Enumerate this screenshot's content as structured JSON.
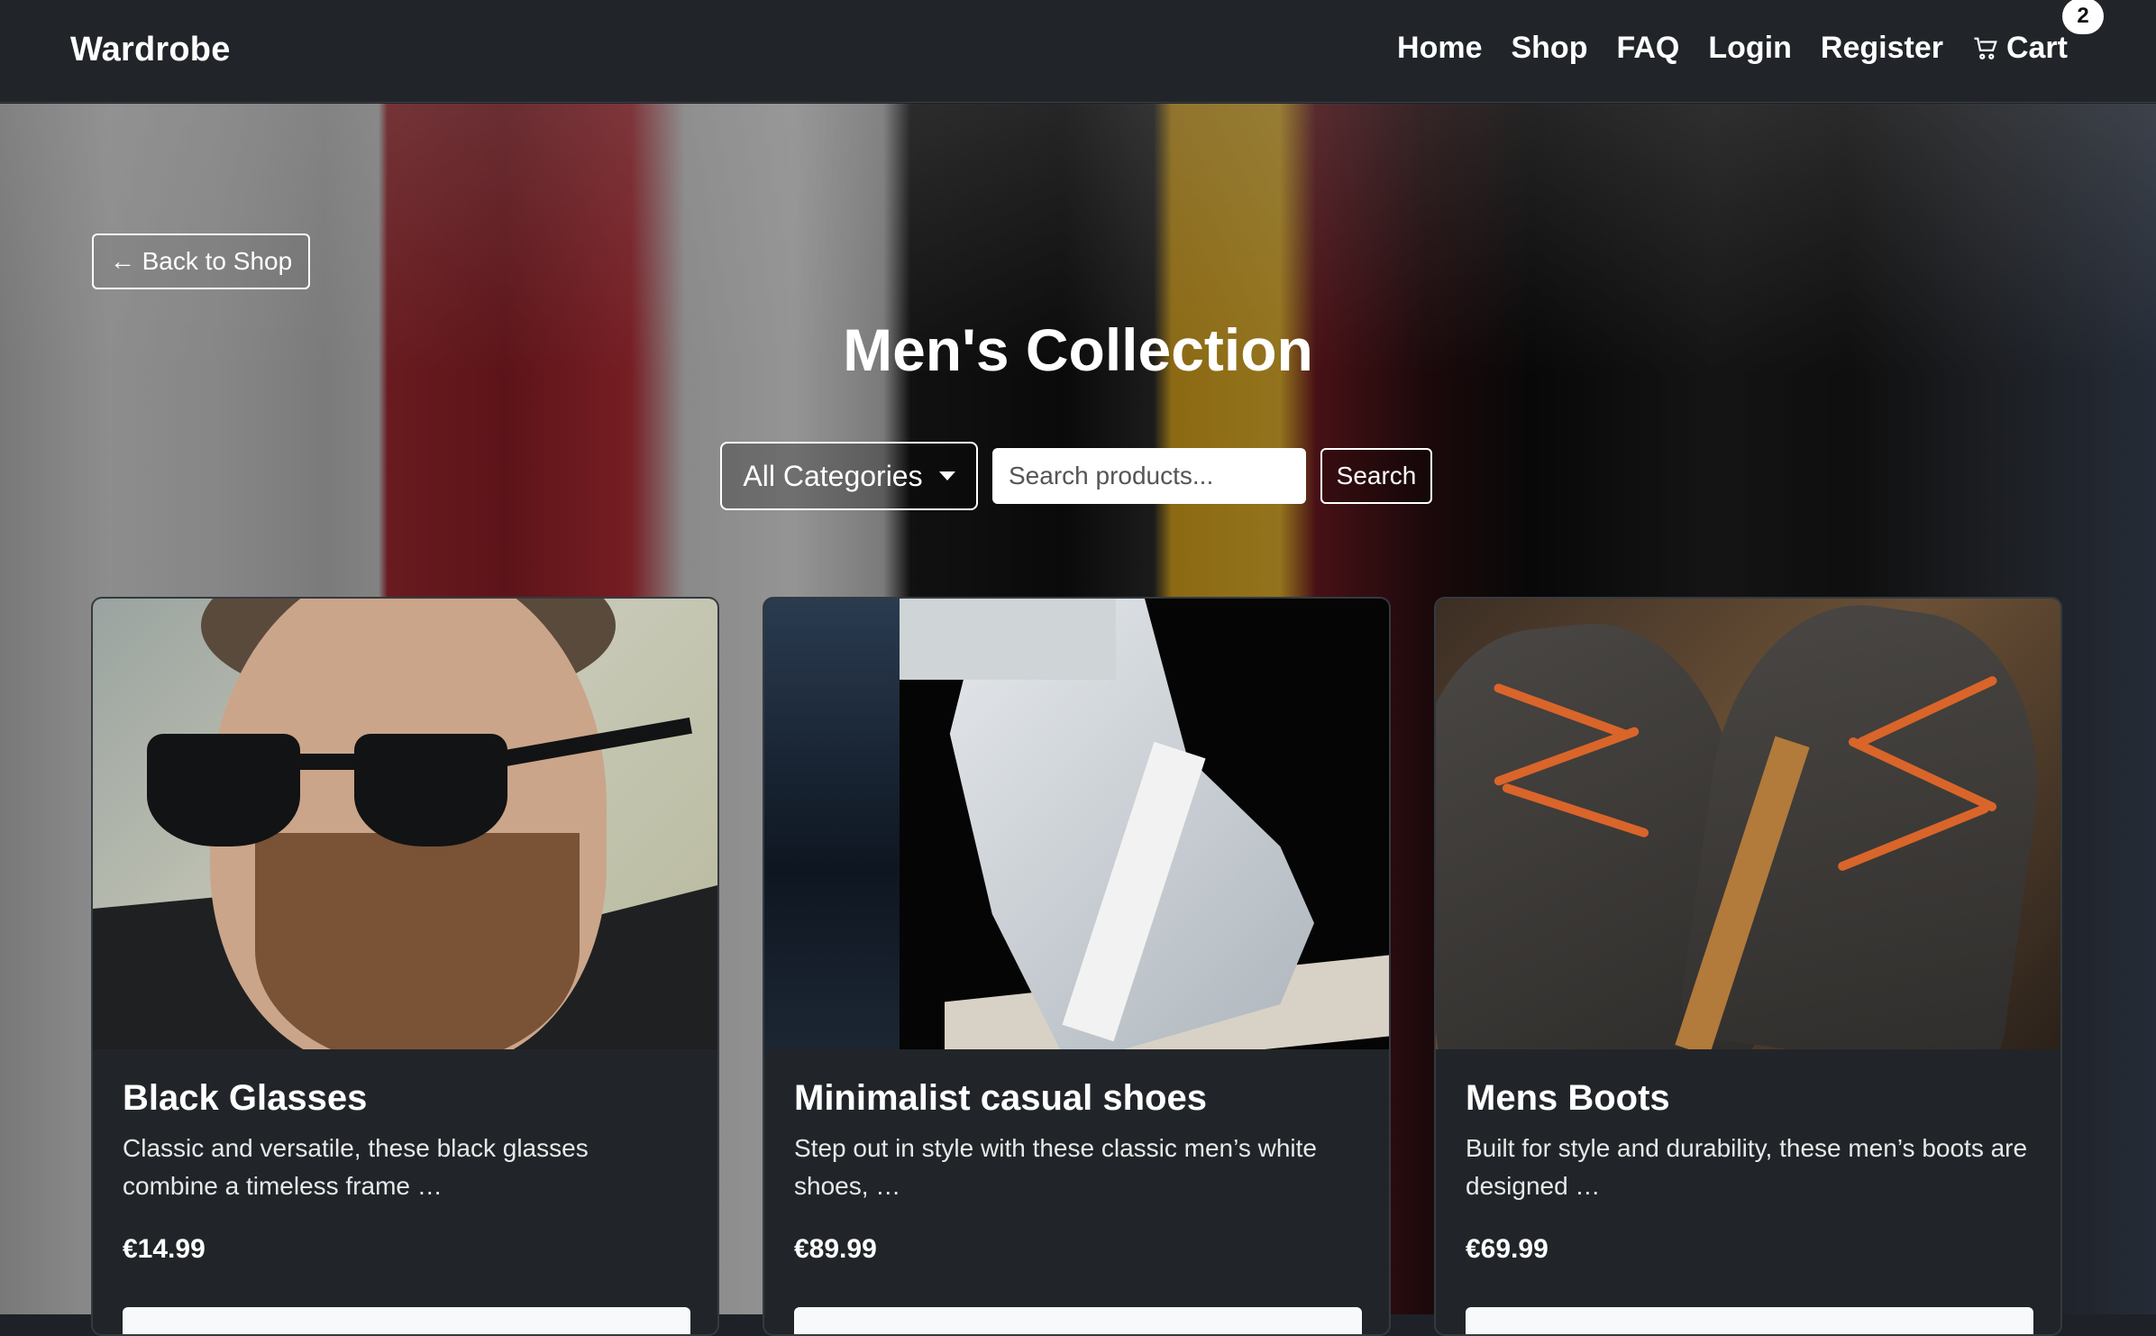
{
  "brand": "Wardrobe",
  "nav": {
    "home": "Home",
    "shop": "Shop",
    "faq": "FAQ",
    "login": "Login",
    "register": "Register",
    "cart": "Cart",
    "cart_count": "2"
  },
  "page": {
    "back_label": "← Back to Shop",
    "title": "Men's Collection"
  },
  "filters": {
    "category": "All Categories",
    "search_placeholder": "Search products...",
    "search_label": "Search"
  },
  "products": [
    {
      "title": "Black Glasses",
      "description": "Classic and versatile, these black glasses combine a timeless frame …",
      "price": "€14.99"
    },
    {
      "title": "Minimalist casual shoes",
      "description": "Step out in style with these classic men’s white shoes, …",
      "price": "€89.99"
    },
    {
      "title": "Mens Boots",
      "description": "Built for style and durability, these men’s boots are designed …",
      "price": "€69.99"
    }
  ],
  "colors": {
    "navbar": "#212529",
    "card": "#212529",
    "text": "#ffffff"
  },
  "icons": {
    "cart": "cart-icon",
    "dropdown": "chevron-down-icon"
  }
}
